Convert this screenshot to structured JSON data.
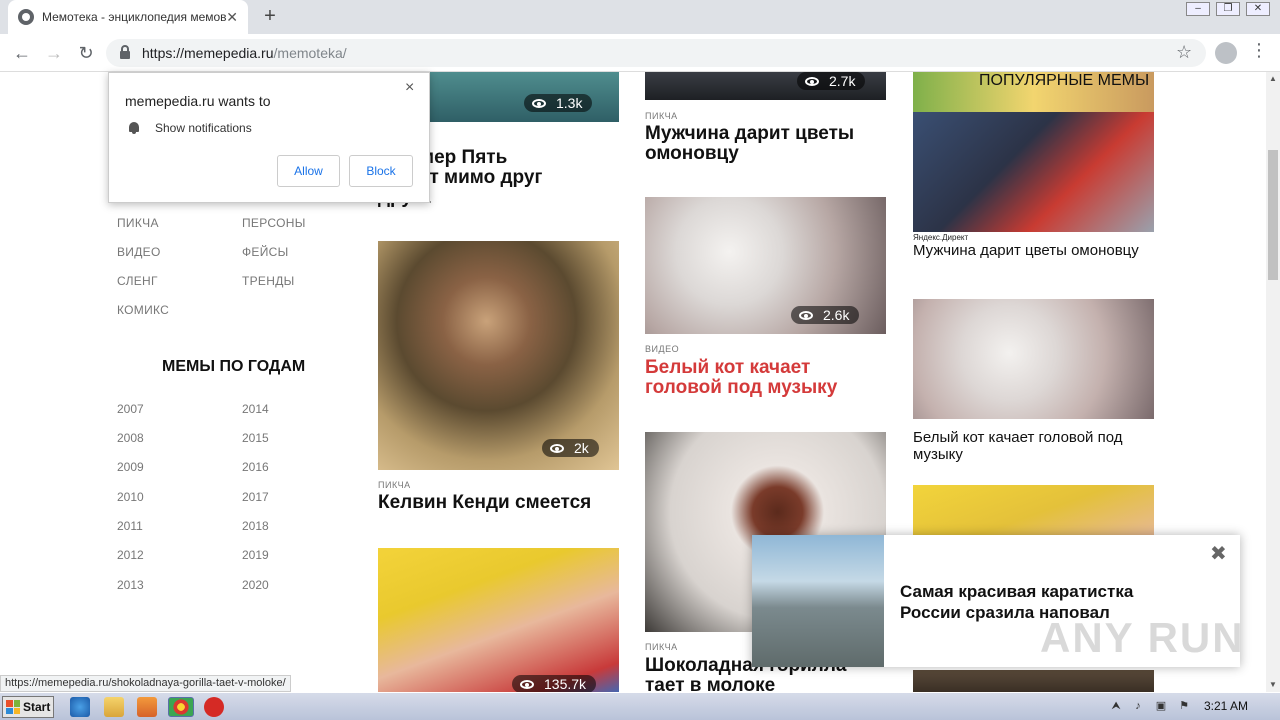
{
  "browser": {
    "tab_title": "Мемотека - энциклопедия мемов",
    "tab_close": "✕",
    "new_tab": "+",
    "url_host": "https://memepedia.ru",
    "url_path": "/memoteka/",
    "status_url": "https://memepedia.ru/shokoladnaya-gorilla-taet-v-moloke/"
  },
  "notification": {
    "title": "memepedia.ru wants to",
    "message": "Show notifications",
    "allow": "Allow",
    "block": "Block",
    "close": "×"
  },
  "sidebar": {
    "categories": [
      "ПИКЧА",
      "ПЕРСОНЫ",
      "ВИДЕО",
      "ФЕЙСЫ",
      "СЛЕНГ",
      "ТРЕНДЫ",
      "КОМИКС"
    ],
    "years_title": "МЕМЫ ПО ГОДАМ",
    "years": [
      "2007",
      "2014",
      "2008",
      "2015",
      "2009",
      "2016",
      "2010",
      "2017",
      "2011",
      "2018",
      "2012",
      "2019",
      "2013",
      "2020"
    ]
  },
  "col1": {
    "views_top": "1.3k",
    "headline_top": "и Номер Пять\nвжают мимо друг\nдруга",
    "card2_views": "2k",
    "card2_cat": "ПИКЧА",
    "card2_title": "Келвин Кенди смеется",
    "card3_views": "135.7k"
  },
  "col2": {
    "views_top": "2.7k",
    "card1_cat": "ПИКЧА",
    "card1_title": "Мужчина дарит цветы омоновцу",
    "card2_views": "2.6k",
    "card2_cat": "ВИДЕО",
    "card2_title": "Белый кот качает головой под музыку",
    "card3_cat": "ПИКЧА",
    "card3_title": "Шоколадная горилла тает в молоке"
  },
  "col3": {
    "popular_label": "ПОПУЛЯРНЫЕ МЕМЫ",
    "yandex": "Яндекс.Директ",
    "item1_title": "Мужчина дарит цветы омоновцу",
    "item2_title": "Белый кот качает головой под музыку"
  },
  "ad": {
    "text": "Самая красивая каратистка России сразила наповал",
    "close": "✖",
    "watermark": "ANY RUN"
  },
  "taskbar": {
    "start": "Start",
    "clock": "3:21 AM"
  }
}
